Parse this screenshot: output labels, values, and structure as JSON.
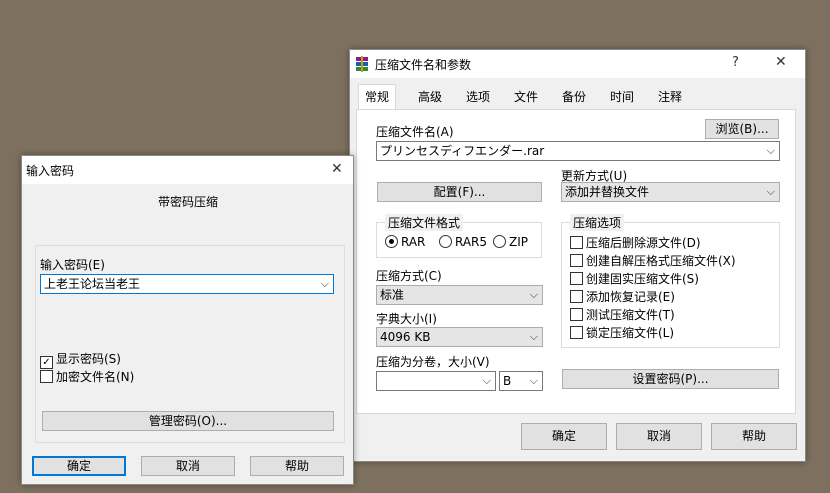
{
  "archive_dialog": {
    "title": "压缩文件名和参数",
    "help_glyph": "?",
    "close_glyph": "✕",
    "tabs": [
      "常规",
      "高级",
      "选项",
      "文件",
      "备份",
      "时间",
      "注释"
    ],
    "filename_label": "压缩文件名(A)",
    "browse_button": "浏览(B)...",
    "filename_value": "プリンセスディフエンダー.rar",
    "update_label": "更新方式(U)",
    "profiles_button": "配置(F)...",
    "update_value": "添加并替换文件",
    "format_group": "压缩文件格式",
    "formats": [
      "RAR",
      "RAR5",
      "ZIP"
    ],
    "selected_format": "RAR",
    "options_group": "压缩选项",
    "options": [
      "压缩后删除源文件(D)",
      "创建自解压格式压缩文件(X)",
      "创建固实压缩文件(S)",
      "添加恢复记录(E)",
      "测试压缩文件(T)",
      "锁定压缩文件(L)"
    ],
    "method_label": "压缩方式(C)",
    "method_value": "标准",
    "dict_label": "字典大小(I)",
    "dict_value": "4096 KB",
    "split_label": "压缩为分卷，大小(V)",
    "split_value": "",
    "split_unit": "B",
    "set_password_button": "设置密码(P)...",
    "ok_button": "确定",
    "cancel_button": "取消",
    "help_button": "帮助"
  },
  "password_dialog": {
    "title": "输入密码",
    "close_glyph": "✕",
    "heading": "带密码压缩",
    "enter_label": "输入密码(E)",
    "password_value": "上老王论坛当老王",
    "show_password": "显示密码(S)",
    "show_password_checked": true,
    "encrypt_names": "加密文件名(N)",
    "encrypt_names_checked": false,
    "organize_button": "管理密码(O)...",
    "ok_button": "确定",
    "cancel_button": "取消",
    "help_button": "帮助"
  },
  "icons": {
    "app_icon": "winrar-books-icon"
  }
}
